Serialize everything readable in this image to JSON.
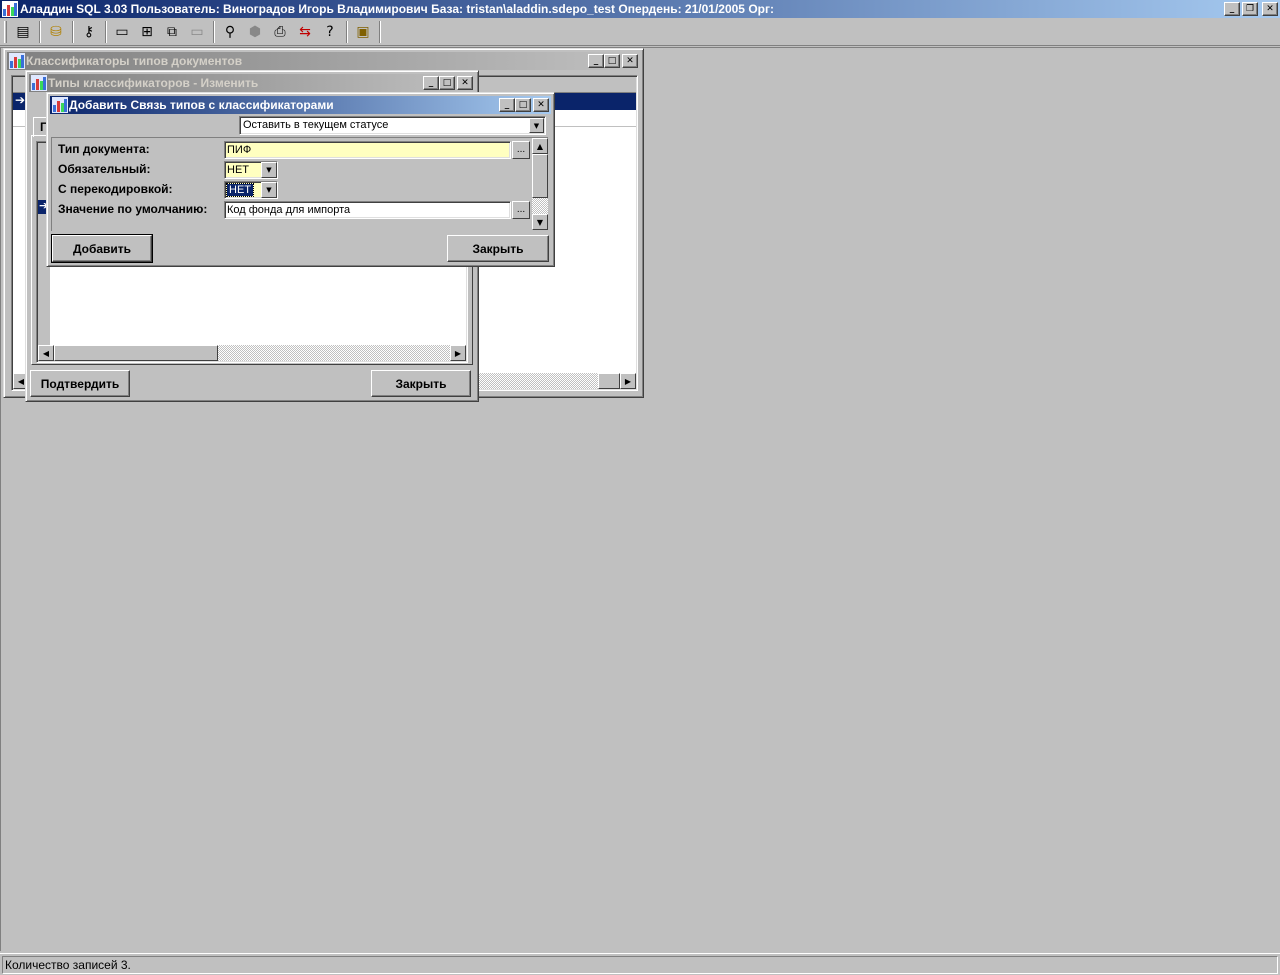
{
  "app": {
    "title": "Аладдин SQL 3.03 Пользователь: Виноградов Игорь Владимирович База: tristan\\aladdin.sdepo_test Опердень: 21/01/2005 Орг:"
  },
  "toolbar": {
    "icons": [
      "list-icon",
      "database-icon",
      "key-icon",
      "window-icon",
      "tile-icon",
      "cascade-icon",
      "minimize-all-icon",
      "binoculars-icon",
      "stop-icon",
      "printer-icon",
      "exchange-icon",
      "help-icon",
      "exit-icon"
    ]
  },
  "windows": {
    "classifiers": {
      "title": "Классификаторы типов документов"
    },
    "types_edit": {
      "title": "Типы классификаторов - Изменить",
      "tab_label": "Г",
      "confirm_label": "Подтвердить",
      "close_label": "Закрыть"
    },
    "add_link": {
      "title": "Добавить Связь типов с классификаторами",
      "status_select": "Оставить в текущем статусе",
      "fields": {
        "doc_type_label": "Тип документа:",
        "doc_type_value": "ПИФ",
        "required_label": "Обязательный:",
        "required_value": "НЕТ",
        "recode_label": "С перекодировкой:",
        "recode_value": "НЕТ",
        "default_label": "Значение по умолчанию:",
        "default_value": "Код фонда для импорта"
      },
      "add_label": "Добавить",
      "close_label": "Закрыть"
    }
  },
  "status": {
    "text": "Количество записей 3."
  },
  "colors": {
    "active_title": "#0a246a",
    "inactive_title": "#808080",
    "desktop": "#c0c0c0",
    "highlight_field": "#ffffc0",
    "selection": "#0a246a"
  }
}
